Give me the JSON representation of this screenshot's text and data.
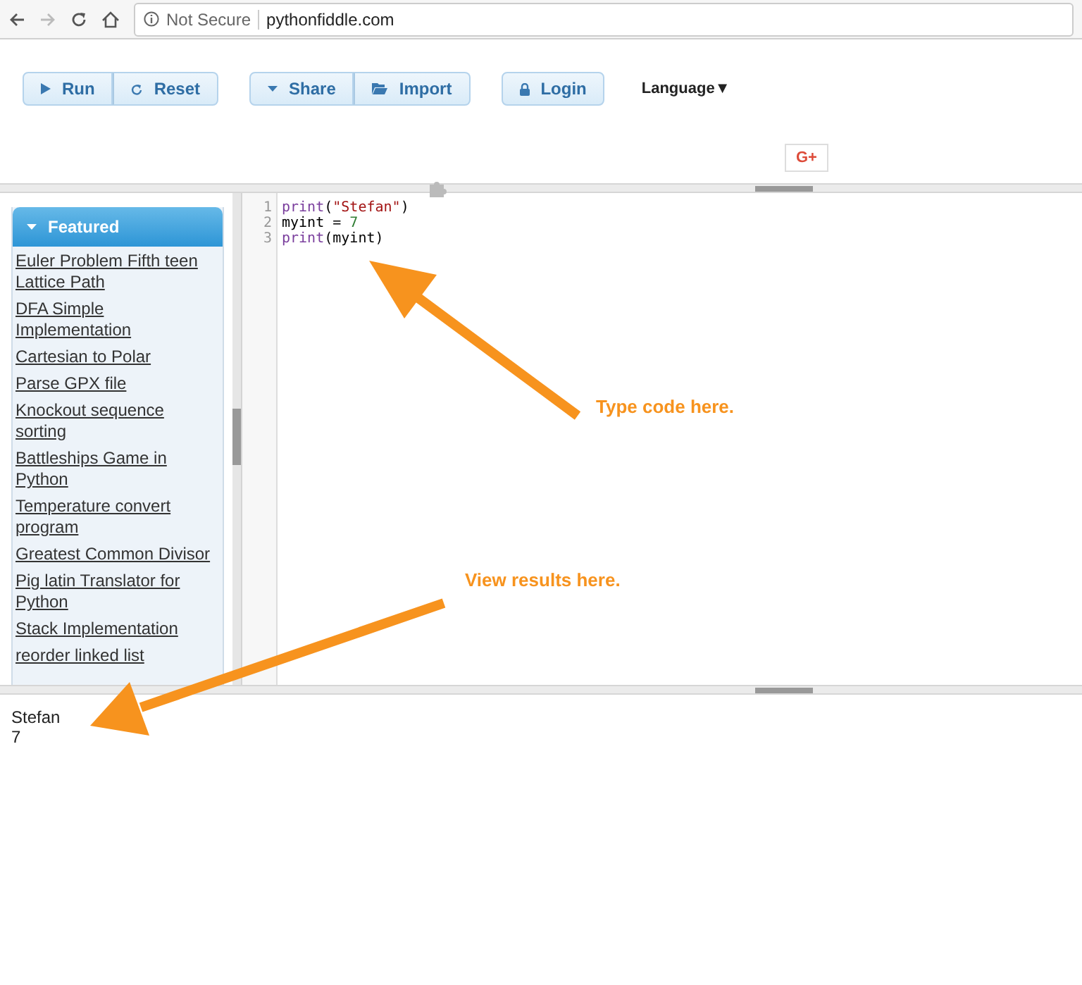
{
  "browser": {
    "security": "Not Secure",
    "url": "pythonfiddle.com"
  },
  "toolbar": {
    "groups": [
      [
        {
          "label": "Run"
        },
        {
          "label": "Reset"
        }
      ],
      [
        {
          "label": "Share"
        },
        {
          "label": "Import"
        }
      ],
      [
        {
          "label": "Login"
        }
      ]
    ],
    "language": "Language▼"
  },
  "social": {
    "label": "G+"
  },
  "sidebar": {
    "title": "Featured",
    "items": [
      "Euler Problem Fifth teen Lattice Path",
      "DFA Simple Implementation",
      "Cartesian to Polar",
      "Parse GPX file",
      "Knockout sequence sorting",
      "Battleships Game in Python",
      "Temperature convert program",
      "Greatest Common Divisor",
      "Pig latin Translator for Python",
      "Stack Implementation",
      "reorder linked list"
    ]
  },
  "editor": {
    "lines": [
      {
        "number": "1",
        "tokens": [
          {
            "kind": "keyword",
            "text": "print"
          },
          {
            "kind": "plain",
            "text": "("
          },
          {
            "kind": "string",
            "text": "\"Stefan\""
          },
          {
            "kind": "plain",
            "text": ")"
          }
        ]
      },
      {
        "number": "2",
        "tokens": [
          {
            "kind": "plain",
            "text": "myint = "
          },
          {
            "kind": "number",
            "text": "7"
          }
        ]
      },
      {
        "number": "3",
        "tokens": [
          {
            "kind": "keyword",
            "text": "print"
          },
          {
            "kind": "plain",
            "text": "(myint)"
          }
        ]
      }
    ]
  },
  "output": {
    "lines": [
      "Stefan",
      "7"
    ]
  },
  "annotations": [
    {
      "text": "Type code here."
    },
    {
      "text": "View results here."
    }
  ]
}
